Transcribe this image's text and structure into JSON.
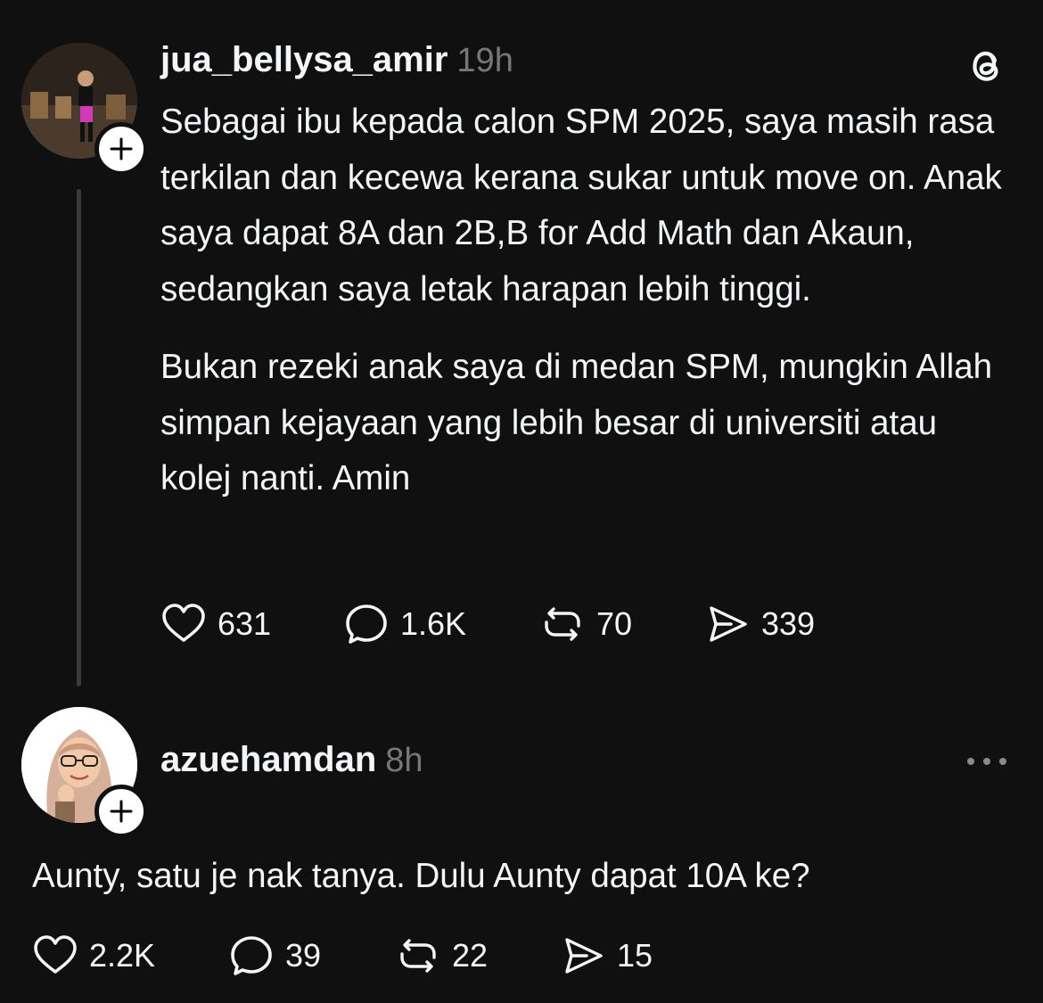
{
  "post": {
    "username": "jua_bellysa_amir",
    "time": "19h",
    "paragraphs": [
      "Sebagai ibu kepada calon SPM 2025, saya masih rasa terkilan dan kecewa kerana sukar untuk move on. Anak saya dapat 8A dan 2B,B for Add Math dan Akaun, sedangkan saya letak harapan lebih tinggi.",
      "Bukan rezeki anak saya di medan SPM, mungkin Allah simpan kejayaan yang lebih besar di universiti atau kolej nanti. Amin"
    ],
    "stats": {
      "likes": "631",
      "replies": "1.6K",
      "reposts": "70",
      "shares": "339"
    }
  },
  "reply": {
    "username": "azuehamdan",
    "time": "8h",
    "text": "Aunty, satu je nak tanya. Dulu Aunty dapat 10A ke?",
    "stats": {
      "likes": "2.2K",
      "replies": "39",
      "reposts": "22",
      "shares": "15"
    }
  },
  "icons": {
    "threads_logo": "threads-logo-icon",
    "follow": "plus-icon",
    "like": "heart-icon",
    "reply": "comment-icon",
    "repost": "repost-icon",
    "share": "send-icon",
    "more": "more-dots-icon"
  },
  "colors": {
    "background": "#101010",
    "text": "#f3f5f7",
    "muted": "#777777",
    "line": "#3a3a3a"
  }
}
